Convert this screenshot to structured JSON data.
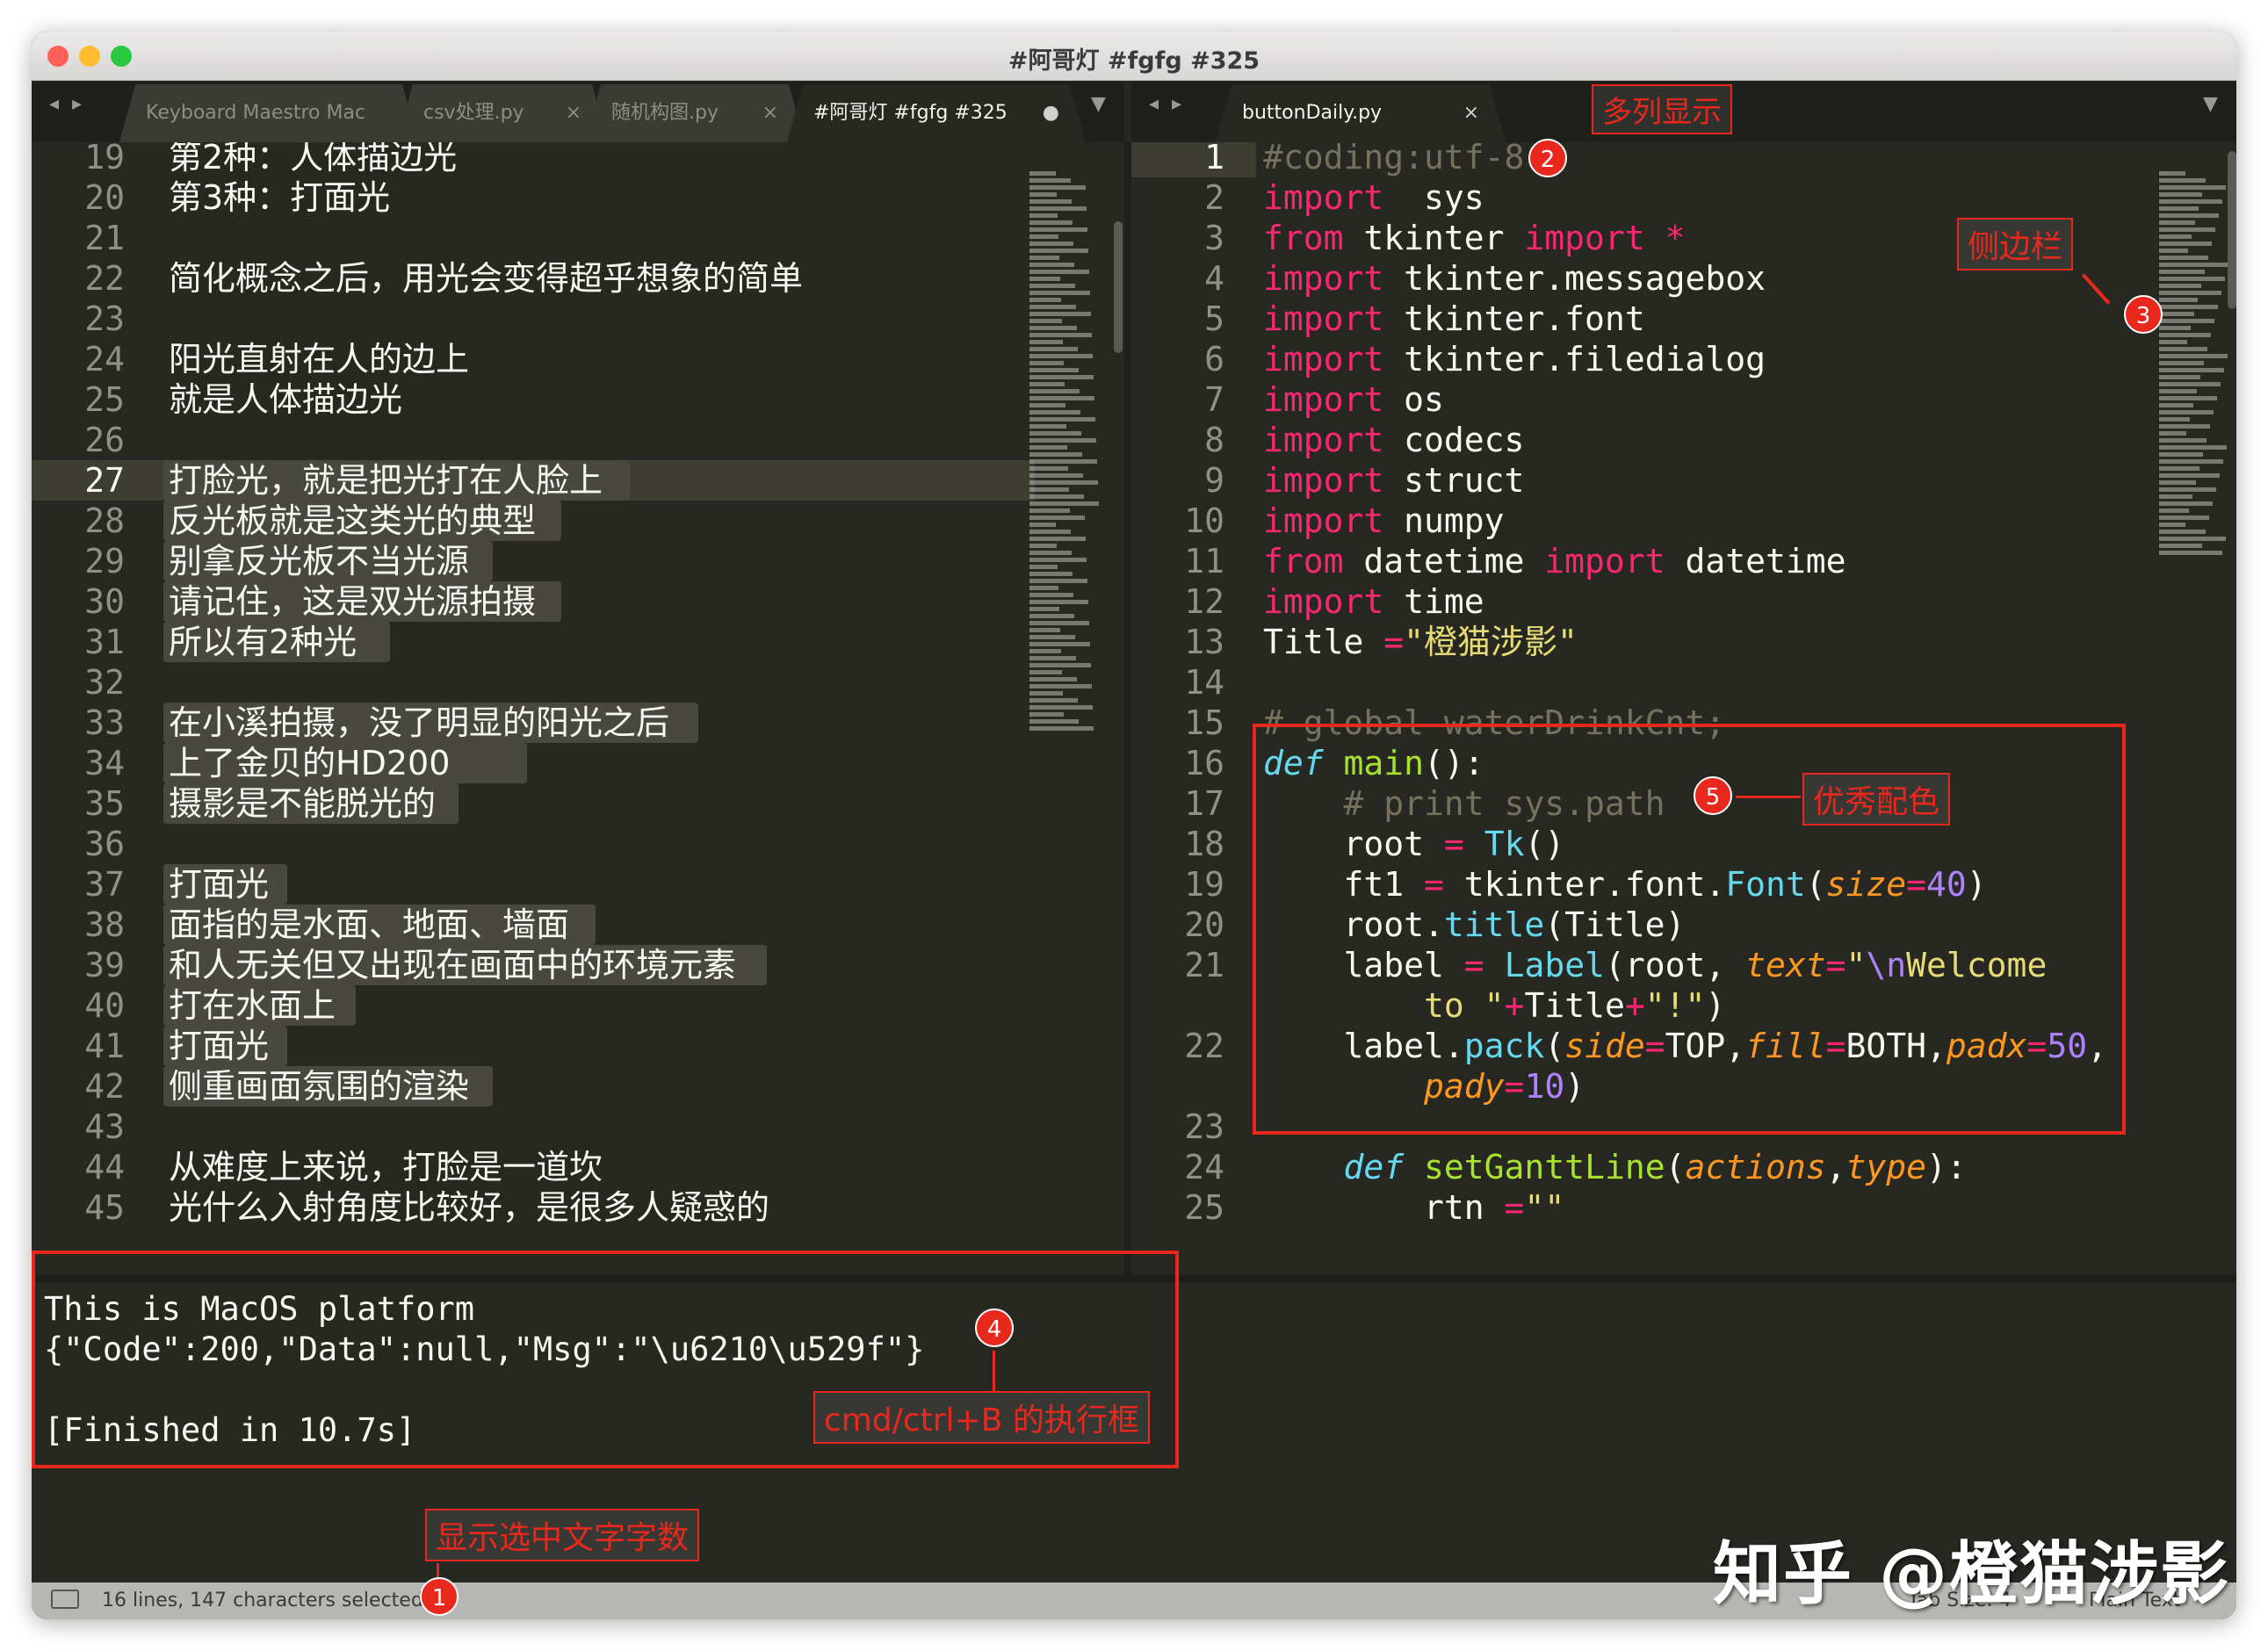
{
  "window": {
    "title": "#阿哥灯 #fgfg #325"
  },
  "colors": {
    "editor_bg": "#272822",
    "keyword": "#f92672",
    "number": "#ae81ff",
    "string": "#e6db74",
    "function": "#a6e22e",
    "builtin": "#66d9ef",
    "comment": "#75715e",
    "annotation": "#e8281d"
  },
  "left_tabs": [
    {
      "label": "Keyboard Maestro Mac",
      "close": ""
    },
    {
      "label": "csv处理.py",
      "close": "×"
    },
    {
      "label": "随机构图.py",
      "close": "×"
    },
    {
      "label": "#阿哥灯 #fgfg #325",
      "close": "●"
    }
  ],
  "right_tabs": [
    {
      "label": "buttonDaily.py",
      "close": "×"
    }
  ],
  "nav": {
    "arrows": "◂ ▸",
    "menu": "▼"
  },
  "left_editor": {
    "lines": [
      {
        "no": "19",
        "text": "第2种：人体描边光"
      },
      {
        "no": "20",
        "text": "第3种：打面光"
      },
      {
        "no": "21",
        "text": ""
      },
      {
        "no": "22",
        "text": "简化概念之后，用光会变得超乎想象的简单"
      },
      {
        "no": "23",
        "text": ""
      },
      {
        "no": "24",
        "text": "阳光直射在人的边上"
      },
      {
        "no": "25",
        "text": "就是人体描边光"
      },
      {
        "no": "26",
        "text": ""
      },
      {
        "no": "27",
        "text": "打脸光，就是把光打在人脸上"
      },
      {
        "no": "28",
        "text": "反光板就是这类光的典型"
      },
      {
        "no": "29",
        "text": "别拿反光板不当光源"
      },
      {
        "no": "30",
        "text": "请记住，这是双光源拍摄"
      },
      {
        "no": "31",
        "text": "所以有2种光"
      },
      {
        "no": "32",
        "text": ""
      },
      {
        "no": "33",
        "text": "在小溪拍摄，没了明显的阳光之后"
      },
      {
        "no": "34",
        "text": "上了金贝的HD200"
      },
      {
        "no": "35",
        "text": "摄影是不能脱光的"
      },
      {
        "no": "36",
        "text": ""
      },
      {
        "no": "37",
        "text": "打面光"
      },
      {
        "no": "38",
        "text": "面指的是水面、地面、墙面"
      },
      {
        "no": "39",
        "text": "和人无关但又出现在画面中的环境元素"
      },
      {
        "no": "40",
        "text": "打在水面上"
      },
      {
        "no": "41",
        "text": "打面光"
      },
      {
        "no": "42",
        "text": "侧重画面氛围的渲染"
      },
      {
        "no": "43",
        "text": ""
      },
      {
        "no": "44",
        "text": "从难度上来说，打脸是一道坎"
      },
      {
        "no": "45",
        "text": "光什么入射角度比较好，是很多人疑惑的"
      }
    ]
  },
  "right_editor": {
    "line_numbers": [
      "1",
      "2",
      "3",
      "4",
      "5",
      "6",
      "7",
      "8",
      "9",
      "10",
      "11",
      "12",
      "13",
      "14",
      "15",
      "16",
      "17",
      "18",
      "19",
      "20",
      "21",
      "",
      "22",
      "",
      "23",
      "24",
      "25"
    ],
    "code": [
      [
        [
          "cm",
          "#coding:utf-8"
        ]
      ],
      [
        [
          "kw",
          "import"
        ],
        [
          "",
          "  sys"
        ]
      ],
      [
        [
          "kw",
          "from"
        ],
        [
          "",
          " tkinter "
        ],
        [
          "kw",
          "import"
        ],
        [
          "",
          " "
        ],
        [
          "kw",
          "*"
        ]
      ],
      [
        [
          "kw",
          "import"
        ],
        [
          "",
          " tkinter.messagebox"
        ]
      ],
      [
        [
          "kw",
          "import"
        ],
        [
          "",
          " tkinter.font"
        ]
      ],
      [
        [
          "kw",
          "import"
        ],
        [
          "",
          " tkinter.filedialog"
        ]
      ],
      [
        [
          "kw",
          "import"
        ],
        [
          "",
          " os"
        ]
      ],
      [
        [
          "kw",
          "import"
        ],
        [
          "",
          " codecs"
        ]
      ],
      [
        [
          "kw",
          "import"
        ],
        [
          "",
          " struct"
        ]
      ],
      [
        [
          "kw",
          "import"
        ],
        [
          "",
          " numpy"
        ]
      ],
      [
        [
          "kw",
          "from"
        ],
        [
          "",
          " datetime "
        ],
        [
          "kw",
          "import"
        ],
        [
          "",
          " datetime"
        ]
      ],
      [
        [
          "kw",
          "import"
        ],
        [
          "",
          " time"
        ]
      ],
      [
        [
          "",
          "Title "
        ],
        [
          "kw",
          "="
        ],
        [
          "str",
          "\"橙猫涉影\""
        ]
      ],
      [
        [
          "",
          ""
        ]
      ],
      [
        [
          "cm",
          "# global waterDrinkCnt;"
        ]
      ],
      [
        [
          "bi ital",
          "def"
        ],
        [
          "",
          " "
        ],
        [
          "fn",
          "main"
        ],
        [
          "",
          "():"
        ]
      ],
      [
        [
          "",
          "    "
        ],
        [
          "cm",
          "# print sys.path"
        ]
      ],
      [
        [
          "",
          "    root "
        ],
        [
          "kw",
          "="
        ],
        [
          "",
          " "
        ],
        [
          "bi",
          "Tk"
        ],
        [
          "",
          "()"
        ]
      ],
      [
        [
          "",
          "    ft1 "
        ],
        [
          "kw",
          "="
        ],
        [
          "",
          " tkinter.font."
        ],
        [
          "bi",
          "Font"
        ],
        [
          "",
          "("
        ],
        [
          "arg",
          "size"
        ],
        [
          "kw",
          "="
        ],
        [
          "nm",
          "40"
        ],
        [
          "",
          ")"
        ]
      ],
      [
        [
          "",
          "    root."
        ],
        [
          "bi",
          "title"
        ],
        [
          "",
          "(Title)"
        ]
      ],
      [
        [
          "",
          "    label "
        ],
        [
          "kw",
          "="
        ],
        [
          "",
          " "
        ],
        [
          "bi",
          "Label"
        ],
        [
          "",
          "(root, "
        ],
        [
          "arg",
          "text"
        ],
        [
          "kw",
          "="
        ],
        [
          "str",
          "\""
        ],
        [
          "nm",
          "\\n"
        ],
        [
          "str",
          "Welcome"
        ]
      ],
      [
        [
          "",
          "        "
        ],
        [
          "str",
          "to "
        ],
        [
          "str",
          "\""
        ],
        [
          "kw",
          "+"
        ],
        [
          "",
          "Title"
        ],
        [
          "kw",
          "+"
        ],
        [
          "str",
          "\"!\""
        ],
        [
          "",
          ")"
        ]
      ],
      [
        [
          "",
          "    label."
        ],
        [
          "bi",
          "pack"
        ],
        [
          "",
          "("
        ],
        [
          "arg",
          "side"
        ],
        [
          "kw",
          "="
        ],
        [
          "",
          "TOP,"
        ],
        [
          "arg",
          "fill"
        ],
        [
          "kw",
          "="
        ],
        [
          "",
          "BOTH,"
        ],
        [
          "arg",
          "padx"
        ],
        [
          "kw",
          "="
        ],
        [
          "nm",
          "50"
        ],
        [
          "",
          ","
        ]
      ],
      [
        [
          "",
          "        "
        ],
        [
          "arg",
          "pady"
        ],
        [
          "kw",
          "="
        ],
        [
          "nm",
          "10"
        ],
        [
          "",
          ")"
        ]
      ],
      [
        [
          "",
          ""
        ]
      ],
      [
        [
          "",
          "    "
        ],
        [
          "bi ital",
          "def"
        ],
        [
          "",
          " "
        ],
        [
          "fn",
          "setGanttLine"
        ],
        [
          "",
          "("
        ],
        [
          "arg",
          "actions"
        ],
        [
          "",
          ","
        ],
        [
          "arg",
          "type"
        ],
        [
          "",
          "):"
        ]
      ],
      [
        [
          "",
          "        rtn "
        ],
        [
          "kw",
          "="
        ],
        [
          "str",
          "\"\""
        ]
      ]
    ]
  },
  "console": {
    "lines": [
      "This is MacOS platform",
      "{\"Code\":200,\"Data\":null,\"Msg\":\"\\u6210\\u529f\"}",
      "",
      "[Finished in 10.7s]"
    ]
  },
  "status_bar": {
    "selection": "16 lines, 147 characters selected",
    "tab_size": "Tab Size: 4",
    "syntax": "Plain Text"
  },
  "annotations": {
    "multi_column": "多列显示",
    "sidebar": "侧边栏",
    "good_colors": "优秀配色",
    "exec_box": "cmd/ctrl+B 的执行框",
    "show_count": "显示选中文字字数",
    "n1": "1",
    "n2": "2",
    "n3": "3",
    "n4": "4",
    "n5": "5"
  },
  "watermark": "知乎 @橙猫涉影"
}
